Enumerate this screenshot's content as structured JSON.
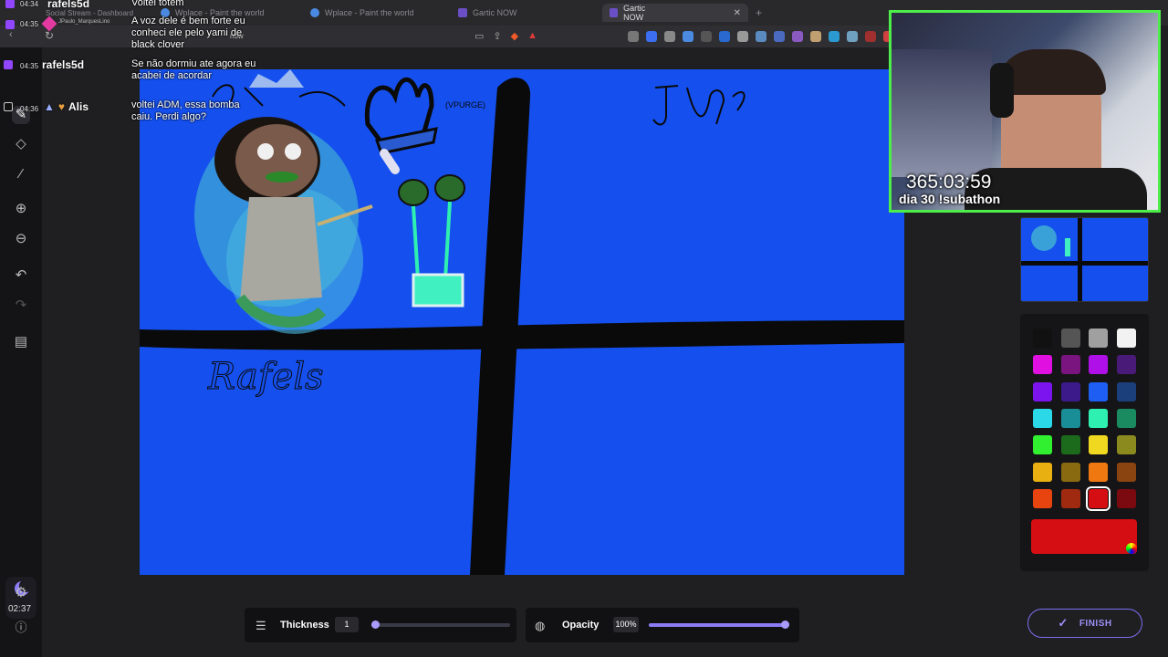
{
  "browser": {
    "tabs": [
      {
        "label": "Social Stream - Dashboard"
      },
      {
        "label": "Wplace - Paint the world"
      },
      {
        "label": "Gartic NOW"
      },
      {
        "label": "Gartic NOW",
        "active": true
      }
    ],
    "address_fragment": "now",
    "bookmark_user": "JPaulo_MarquesLino"
  },
  "sidebar": {
    "timer": "02:37"
  },
  "chat": [
    {
      "time": "04:34",
      "user": "rafels5d",
      "platform": "twitch",
      "message": "Voltei totem"
    },
    {
      "time": "04:35",
      "user": "",
      "platform": "twitch",
      "message": "A voz dele é bem forte eu conheci ele pelo yami de black clover"
    },
    {
      "time": "04:35",
      "user": "rafels5d",
      "platform": "twitch",
      "message": "Se não dormiu ate agora eu acabei de acordar"
    },
    {
      "time": "04:36",
      "user": "Alis",
      "platform": "tiktok",
      "message": "voltei ADM, essa bomba caiu. Perdi algo?"
    }
  ],
  "webcam": {
    "timer": "365:03:59",
    "subtitle": "dia 30 !subathon",
    "border_color": "#4dee4a"
  },
  "palette": {
    "colors": [
      "#111111",
      "#555555",
      "#a0a0a0",
      "#f2f2f2",
      "#e010e0",
      "#7a1580",
      "#b010e8",
      "#4a1a78",
      "#7c14f0",
      "#3c1a8a",
      "#1e5ef2",
      "#1b3f7a",
      "#2ad8e8",
      "#1a8e96",
      "#2ef0b0",
      "#1a8a60",
      "#30f030",
      "#1c6a1c",
      "#f0d820",
      "#8a8a1e",
      "#e8b010",
      "#8a6a10",
      "#f07810",
      "#8a4410",
      "#e84410",
      "#a02a10",
      "#d40e12",
      "#7a0a10"
    ],
    "selected_index": 26,
    "current_color": "#d40e12"
  },
  "tools": {
    "thickness_label": "Thickness",
    "thickness_value": "1",
    "thickness_fraction": 0.0,
    "opacity_label": "Opacity",
    "opacity_value": "100%",
    "opacity_fraction": 1.0
  },
  "finish_label": "FINISH",
  "canvas": {
    "background": "#1550ef",
    "handwriting_label": "Rafels"
  }
}
